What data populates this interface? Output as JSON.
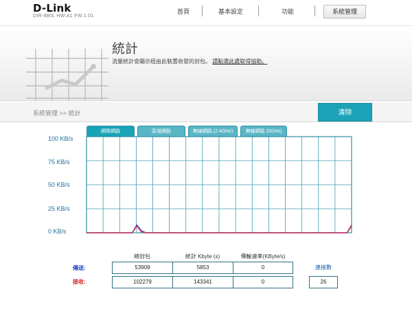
{
  "header": {
    "brand": "D-Link",
    "model": "DIR-880L   HW:A1   FW:1.01",
    "nav": [
      {
        "label": "首頁"
      },
      {
        "label": "基本設定"
      },
      {
        "label": "功能"
      },
      {
        "label": "系統管理"
      }
    ]
  },
  "banner": {
    "title": "統計",
    "description": "流量統計會顯示經由此裝置收發的封包。",
    "help_link": "請點選此處取得協助。"
  },
  "breadcrumb": "系統管理 >> 統計",
  "clear_button": "清除",
  "tabs": [
    {
      "label": "網際網路"
    },
    {
      "label": "區域網路"
    },
    {
      "label": "無線網路 (2.4GHz)"
    },
    {
      "label": "無線網路 (5GHz)"
    }
  ],
  "chart_data": {
    "type": "line",
    "y_ticks": [
      "100 KB/s",
      "75 KB/s",
      "50 KB/s",
      "25 KB/s",
      "0 KB/s"
    ],
    "ylim": [
      0,
      100
    ],
    "series": [
      {
        "name": "傳送",
        "color": "#2b3fc0",
        "values": [
          0,
          0,
          0,
          0,
          0,
          0,
          0,
          0,
          0,
          0,
          0,
          8,
          2,
          0,
          0,
          0,
          0,
          0,
          0,
          0,
          0,
          0,
          0,
          0,
          0,
          0,
          0,
          0,
          0,
          0,
          0,
          0,
          0,
          0,
          0,
          0,
          0,
          0,
          0,
          0,
          0,
          0,
          0,
          0,
          0,
          0,
          0,
          0,
          0,
          0,
          0,
          0,
          0,
          0,
          0,
          0,
          0,
          0,
          7
        ]
      },
      {
        "name": "接收",
        "color": "#d03a5a",
        "values": [
          0,
          0,
          0,
          0,
          0,
          0,
          0,
          0,
          0,
          0,
          0,
          7,
          1,
          0,
          0,
          0,
          0,
          0,
          0,
          0,
          0,
          0,
          0,
          0,
          0,
          0,
          0,
          0,
          0,
          0,
          0,
          0,
          0,
          0,
          0,
          0,
          0,
          0,
          0,
          0,
          0,
          0,
          0,
          0,
          0,
          0,
          0,
          0,
          0,
          0,
          0,
          0,
          0,
          0,
          0,
          0,
          0,
          0,
          8
        ]
      }
    ],
    "grid": true
  },
  "table": {
    "headers": [
      "總封包",
      "統計 Kbyte (s)",
      "傳輸速率(KByte/s)"
    ],
    "rows": [
      {
        "label": "傳送:",
        "color": "#1a3fbf",
        "values": [
          "53909",
          "5853",
          "0"
        ]
      },
      {
        "label": "接收:",
        "color": "#d02a2a",
        "values": [
          "102279",
          "143341",
          "0"
        ]
      }
    ],
    "connections_label": "連接數",
    "connections_value": "26"
  }
}
